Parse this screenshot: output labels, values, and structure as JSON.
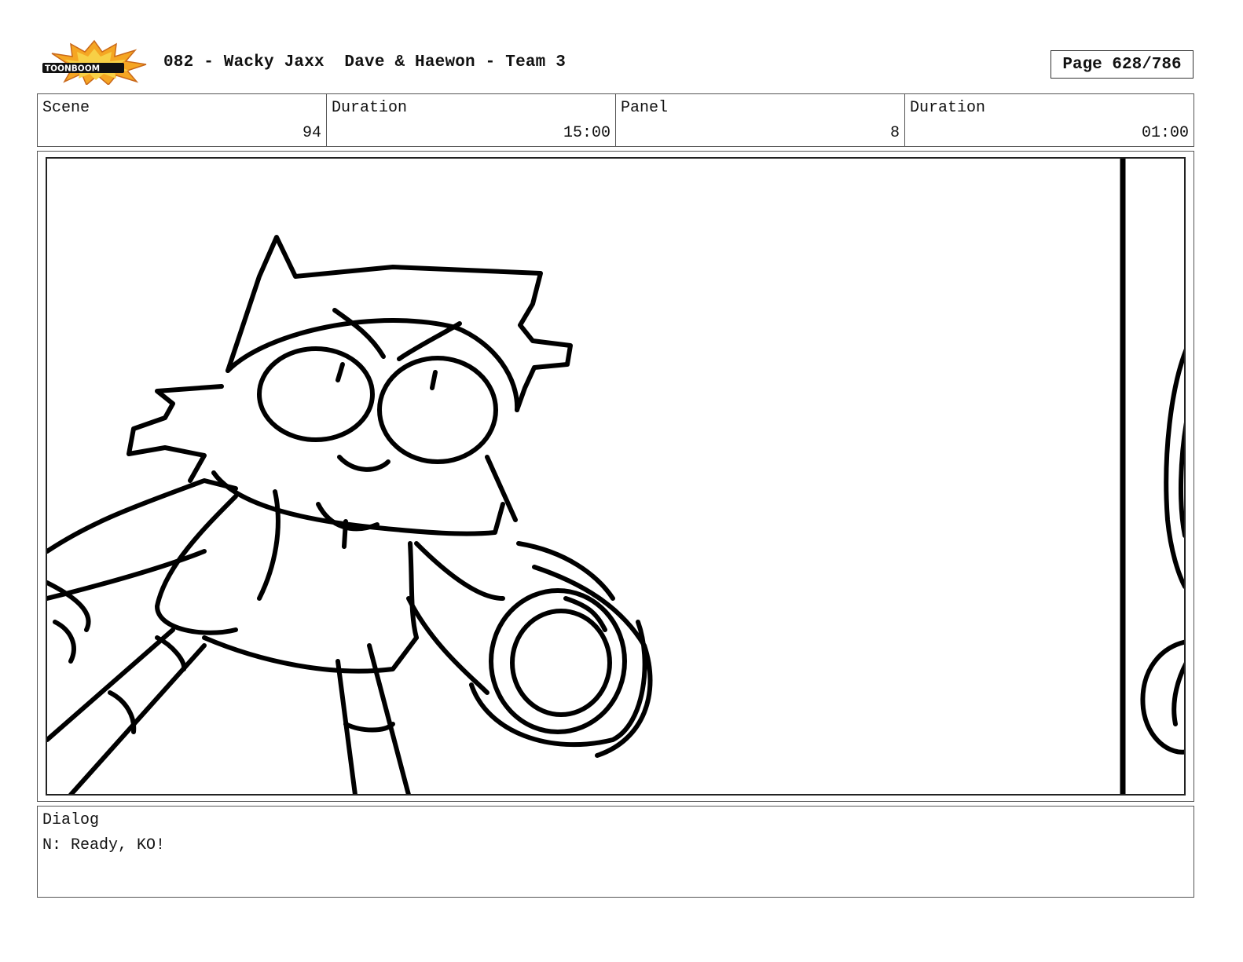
{
  "header": {
    "logo_text": "TOONBOOM",
    "title": "082 - Wacky Jaxx  Dave & Haewon - Team 3",
    "page": "Page 628/786"
  },
  "info": {
    "scene_label": "Scene",
    "scene_value": "94",
    "scene_duration_label": "Duration",
    "scene_duration_value": "15:00",
    "panel_label": "Panel",
    "panel_value": "8",
    "panel_duration_label": "Duration",
    "panel_duration_value": "01:00"
  },
  "dialog": {
    "label": "Dialog",
    "text": "N: Ready, KO!"
  },
  "colors": {
    "logo_burst": "#f5a623",
    "logo_burst_inner": "#f7d046",
    "ink": "#000000"
  }
}
